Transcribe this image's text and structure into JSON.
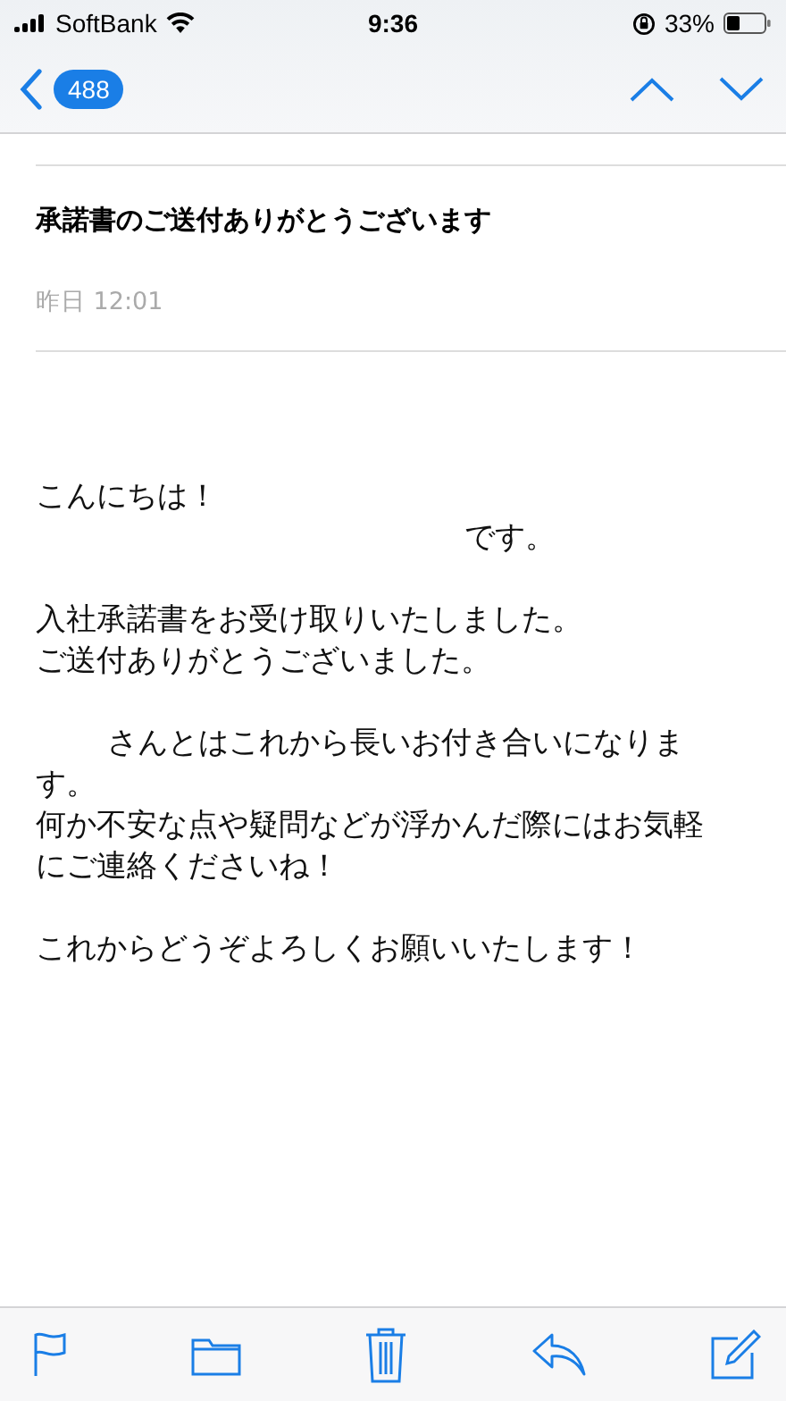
{
  "status_bar": {
    "carrier": "SoftBank",
    "time": "9:36",
    "battery": "33%"
  },
  "nav": {
    "unread_count": "488"
  },
  "message": {
    "subject": "承諾書のご送付ありがとうございます",
    "date": "昨日 12:01",
    "lines": [
      {
        "kind": "plain",
        "text": "こんにちは！"
      },
      {
        "kind": "long_gap",
        "text": "です。"
      },
      {
        "kind": "break"
      },
      {
        "kind": "plain",
        "text": "入社承諾書をお受け取りいたしました。"
      },
      {
        "kind": "plain",
        "text": "ご送付ありがとうございました。"
      },
      {
        "kind": "break"
      },
      {
        "kind": "short_gap",
        "text": "さんとはこれから長いお付き合いになりま"
      },
      {
        "kind": "plain",
        "text": "す。"
      },
      {
        "kind": "plain",
        "text": "何か不安な点や疑問などが浮かんだ際にはお気軽"
      },
      {
        "kind": "plain",
        "text": "にご連絡くださいね！"
      },
      {
        "kind": "break"
      },
      {
        "kind": "plain",
        "text": "これからどうぞよろしくお願いいたします！"
      }
    ]
  }
}
